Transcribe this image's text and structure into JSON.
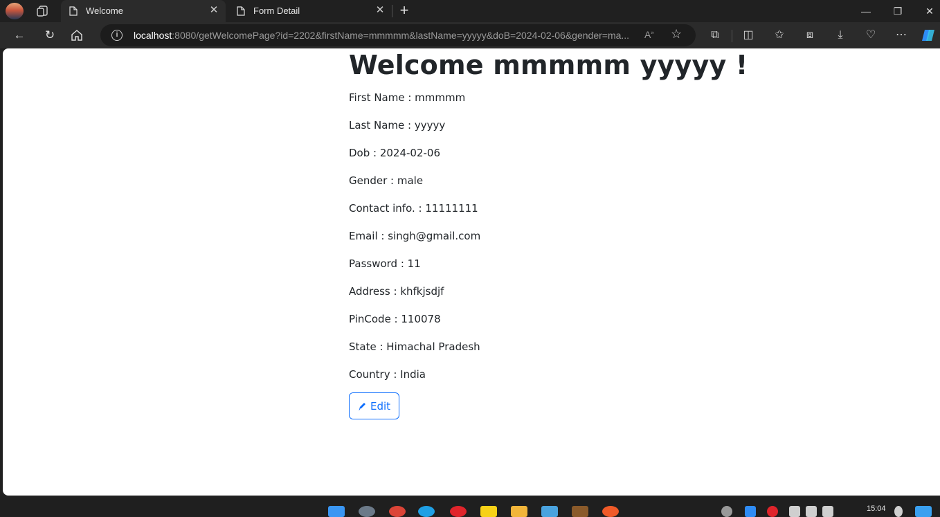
{
  "browser": {
    "tabs": [
      {
        "title": "Welcome",
        "active": true
      },
      {
        "title": "Form Detail",
        "active": false
      }
    ],
    "address": {
      "host": "localhost",
      "rest": ":8080/getWelcomePage?id=2202&firstName=mmmmm&lastName=yyyyy&doB=2024-02-06&gender=ma..."
    },
    "controls": {
      "minimize": "—",
      "maximize": "❐",
      "close": "✕"
    }
  },
  "page": {
    "heading": "Welcome mmmmm yyyyy !",
    "fields": [
      {
        "label": "First Name",
        "value": "mmmmm",
        "text": "First Name : mmmmm"
      },
      {
        "label": "Last Name",
        "value": "yyyyy",
        "text": "Last Name : yyyyy"
      },
      {
        "label": "Dob",
        "value": "2024-02-06",
        "text": "Dob : 2024-02-06"
      },
      {
        "label": "Gender",
        "value": "male",
        "text": "Gender : male"
      },
      {
        "label": "Contact info.",
        "value": "11111111",
        "text": "Contact info. : 11111111"
      },
      {
        "label": "Email",
        "value": "singh@gmail.com",
        "text": "Email : singh@gmail.com"
      },
      {
        "label": "Password",
        "value": "11",
        "text": "Password : 11"
      },
      {
        "label": "Address",
        "value": "khfkjsdjf",
        "text": "Address : khfkjsdjf"
      },
      {
        "label": "PinCode",
        "value": "110078",
        "text": "PinCode : 110078"
      },
      {
        "label": "State",
        "value": "Himachal Pradesh",
        "text": "State : Himachal Pradesh"
      },
      {
        "label": "Country",
        "value": "India",
        "text": "Country : India"
      }
    ],
    "edit_label": "Edit"
  },
  "taskbar": {
    "time": "15:04"
  },
  "colors": {
    "accent": "#0d6efd",
    "text": "#212529",
    "chrome_dark": "#202020",
    "chrome_toolbar": "#2b2b2b"
  }
}
